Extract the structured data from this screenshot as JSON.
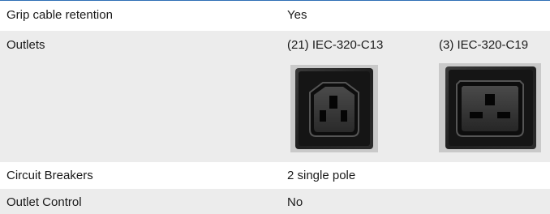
{
  "rows": [
    {
      "label": "Grip cable retention",
      "value": "Yes"
    },
    {
      "label": "Outlets",
      "values": [
        "(21) IEC-320-C13",
        "(3) IEC-320-C19"
      ]
    },
    {
      "label": "Circuit Breakers",
      "value": "2 single pole"
    },
    {
      "label": "Outlet Control",
      "value": "No"
    }
  ],
  "outlet_images": [
    "iec-c13-socket-icon",
    "iec-c19-socket-icon"
  ],
  "colors": {
    "top_rule": "#2f6fb5",
    "shaded_row": "#ececec",
    "text": "#1a1a1a"
  }
}
